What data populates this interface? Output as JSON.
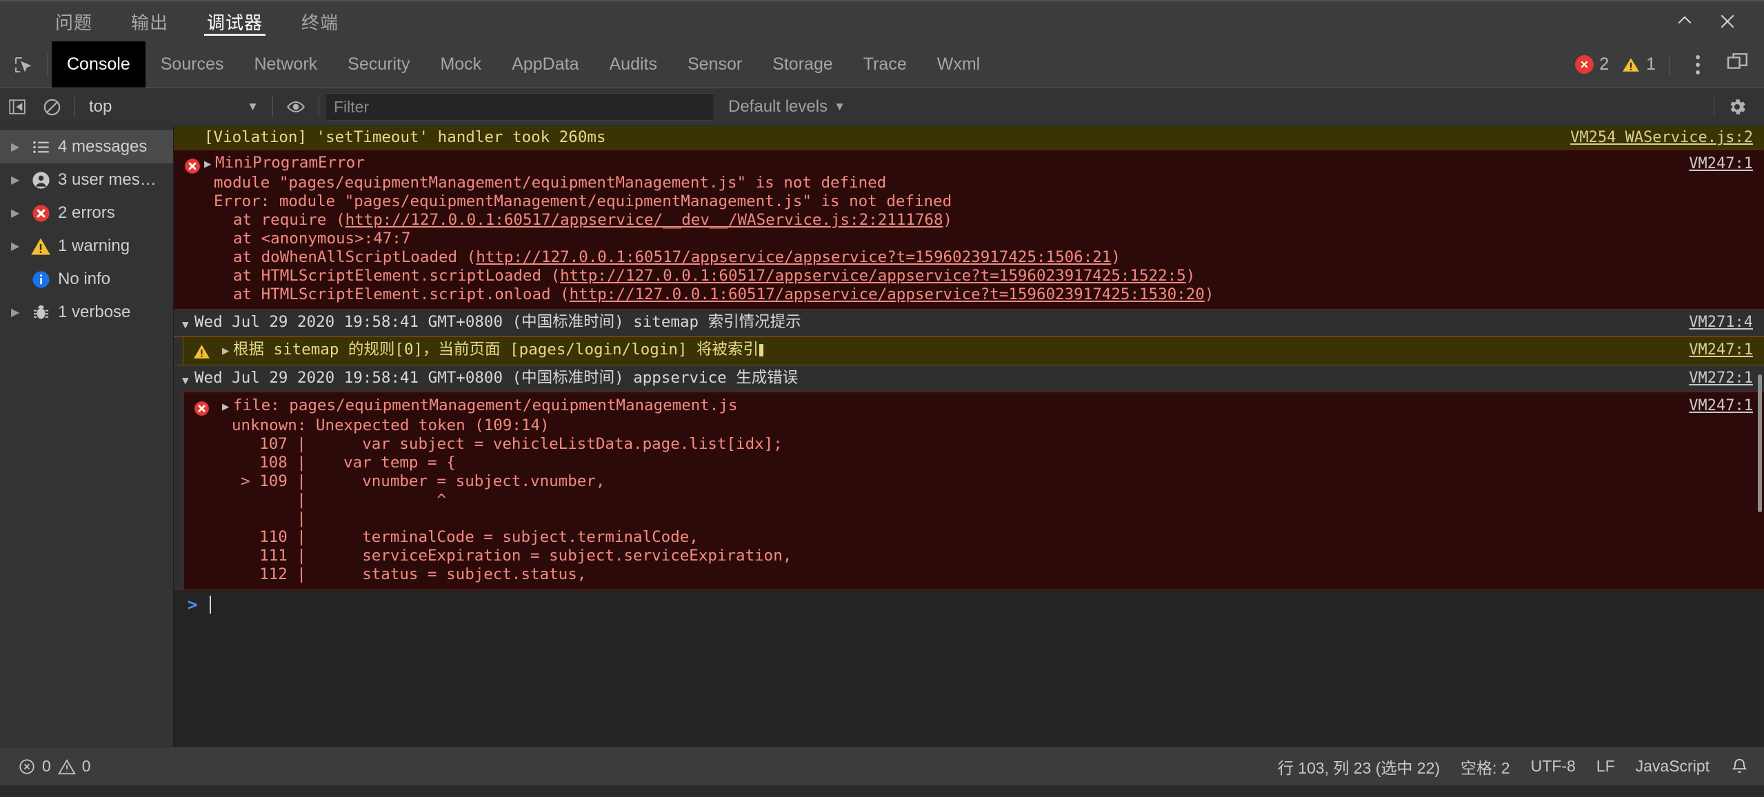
{
  "panel": {
    "tabs": [
      {
        "label": "问题",
        "active": false
      },
      {
        "label": "输出",
        "active": false
      },
      {
        "label": "调试器",
        "active": true
      },
      {
        "label": "终端",
        "active": false
      }
    ],
    "window_controls": [
      "chevron-up-icon",
      "close-icon"
    ]
  },
  "devtools": {
    "inspect_icon": "inspect-element-icon",
    "tabs": [
      {
        "label": "Console",
        "active": true
      },
      {
        "label": "Sources",
        "active": false
      },
      {
        "label": "Network",
        "active": false
      },
      {
        "label": "Security",
        "active": false
      },
      {
        "label": "Mock",
        "active": false
      },
      {
        "label": "AppData",
        "active": false
      },
      {
        "label": "Audits",
        "active": false
      },
      {
        "label": "Sensor",
        "active": false
      },
      {
        "label": "Storage",
        "active": false
      },
      {
        "label": "Trace",
        "active": false
      },
      {
        "label": "Wxml",
        "active": false
      }
    ],
    "error_count": "2",
    "warning_count": "1",
    "more_icon": "kebab-menu-icon",
    "dock_icon": "dock-position-icon"
  },
  "console_toolbar": {
    "sidebar_toggle_icon": "show-console-sidebar-icon",
    "clear_icon": "clear-console-icon",
    "context": "top",
    "context_caret": "▼",
    "live_expression_icon": "eye-icon",
    "filter_placeholder": "Filter",
    "filter_value": "",
    "levels_label": "Default levels",
    "levels_caret": "▼",
    "settings_icon": "gear-icon"
  },
  "sidebar": {
    "items": [
      {
        "label": "4 messages",
        "icon": "list-icon",
        "arrow": true,
        "selected": true
      },
      {
        "label": "3 user mes…",
        "icon": "user-icon",
        "arrow": true,
        "selected": false
      },
      {
        "label": "2 errors",
        "icon": "error-icon",
        "arrow": true,
        "selected": false
      },
      {
        "label": "1 warning",
        "icon": "warning-icon",
        "arrow": true,
        "selected": false
      },
      {
        "label": "No info",
        "icon": "info-icon",
        "arrow": false,
        "selected": false
      },
      {
        "label": "1 verbose",
        "icon": "bug-icon",
        "arrow": true,
        "selected": false
      }
    ]
  },
  "console": {
    "violation": {
      "text": "[Violation] 'setTimeout' handler took 260ms",
      "link": "VM254 WAService.js:2"
    },
    "error1": {
      "title": "MiniProgramError",
      "line1": "module \"pages/equipmentManagement/equipmentManagement.js\" is not defined",
      "line2": "Error: module \"pages/equipmentManagement/equipmentManagement.js\" is not defined",
      "stack": [
        {
          "prefix": "at require (",
          "link": "http://127.0.0.1:60517/appservice/__dev__/WAService.js:2:2111768",
          "suffix": ")"
        },
        {
          "prefix": "at <anonymous>:47:7",
          "link": "",
          "suffix": ""
        },
        {
          "prefix": "at doWhenAllScriptLoaded (",
          "link": "http://127.0.0.1:60517/appservice/appservice?t=1596023917425:1506:21",
          "suffix": ")"
        },
        {
          "prefix": "at HTMLScriptElement.scriptLoaded (",
          "link": "http://127.0.0.1:60517/appservice/appservice?t=1596023917425:1522:5",
          "suffix": ")"
        },
        {
          "prefix": "at HTMLScriptElement.script.onload (",
          "link": "http://127.0.0.1:60517/appservice/appservice?t=1596023917425:1530:20",
          "suffix": ")"
        }
      ],
      "link": "VM247:1"
    },
    "group1": {
      "caret": "▼",
      "text": "Wed Jul 29 2020 19:58:41 GMT+0800 (中国标准时间) sitemap 索引情况提示",
      "link": "VM271:4"
    },
    "warning": {
      "disclosure": "▶",
      "text": "根据 sitemap 的规则[0]，当前页面 [pages/login/login] 将被索引",
      "link": "VM247:1"
    },
    "group2": {
      "caret": "▼",
      "text": "Wed Jul 29 2020 19:58:41 GMT+0800 (中国标准时间)  appservice 生成错误",
      "link": "VM272:1"
    },
    "error2": {
      "title": "file: pages/equipmentManagement/equipmentManagement.js",
      "subtitle": "unknown: Unexpected token (109:14)",
      "code_lines": [
        "    107 |      var subject = vehicleListData.page.list[idx];",
        "    108 |    var temp = {",
        "  > 109 |      vnumber = subject.vnumber,",
        "        |              ^",
        "        |",
        "    110 |      terminalCode = subject.terminalCode,",
        "    111 |      serviceExpiration = subject.serviceExpiration,",
        "    112 |      status = subject.status,"
      ],
      "link": "VM247:1"
    },
    "prompt": ">"
  },
  "status_bar": {
    "errors": "0",
    "warnings": "0",
    "cursor": "行 103, 列 23 (选中 22)",
    "indent": "空格: 2",
    "encoding": "UTF-8",
    "eol": "LF",
    "language": "JavaScript",
    "bell_icon": "notification-bell-icon"
  },
  "colors": {
    "accent": "#4d8fe8",
    "error": "#e53935",
    "warning": "#f2c037",
    "info": "#1a73e8",
    "error_bg": "#2d0a0a",
    "warning_bg": "#3a3306"
  }
}
